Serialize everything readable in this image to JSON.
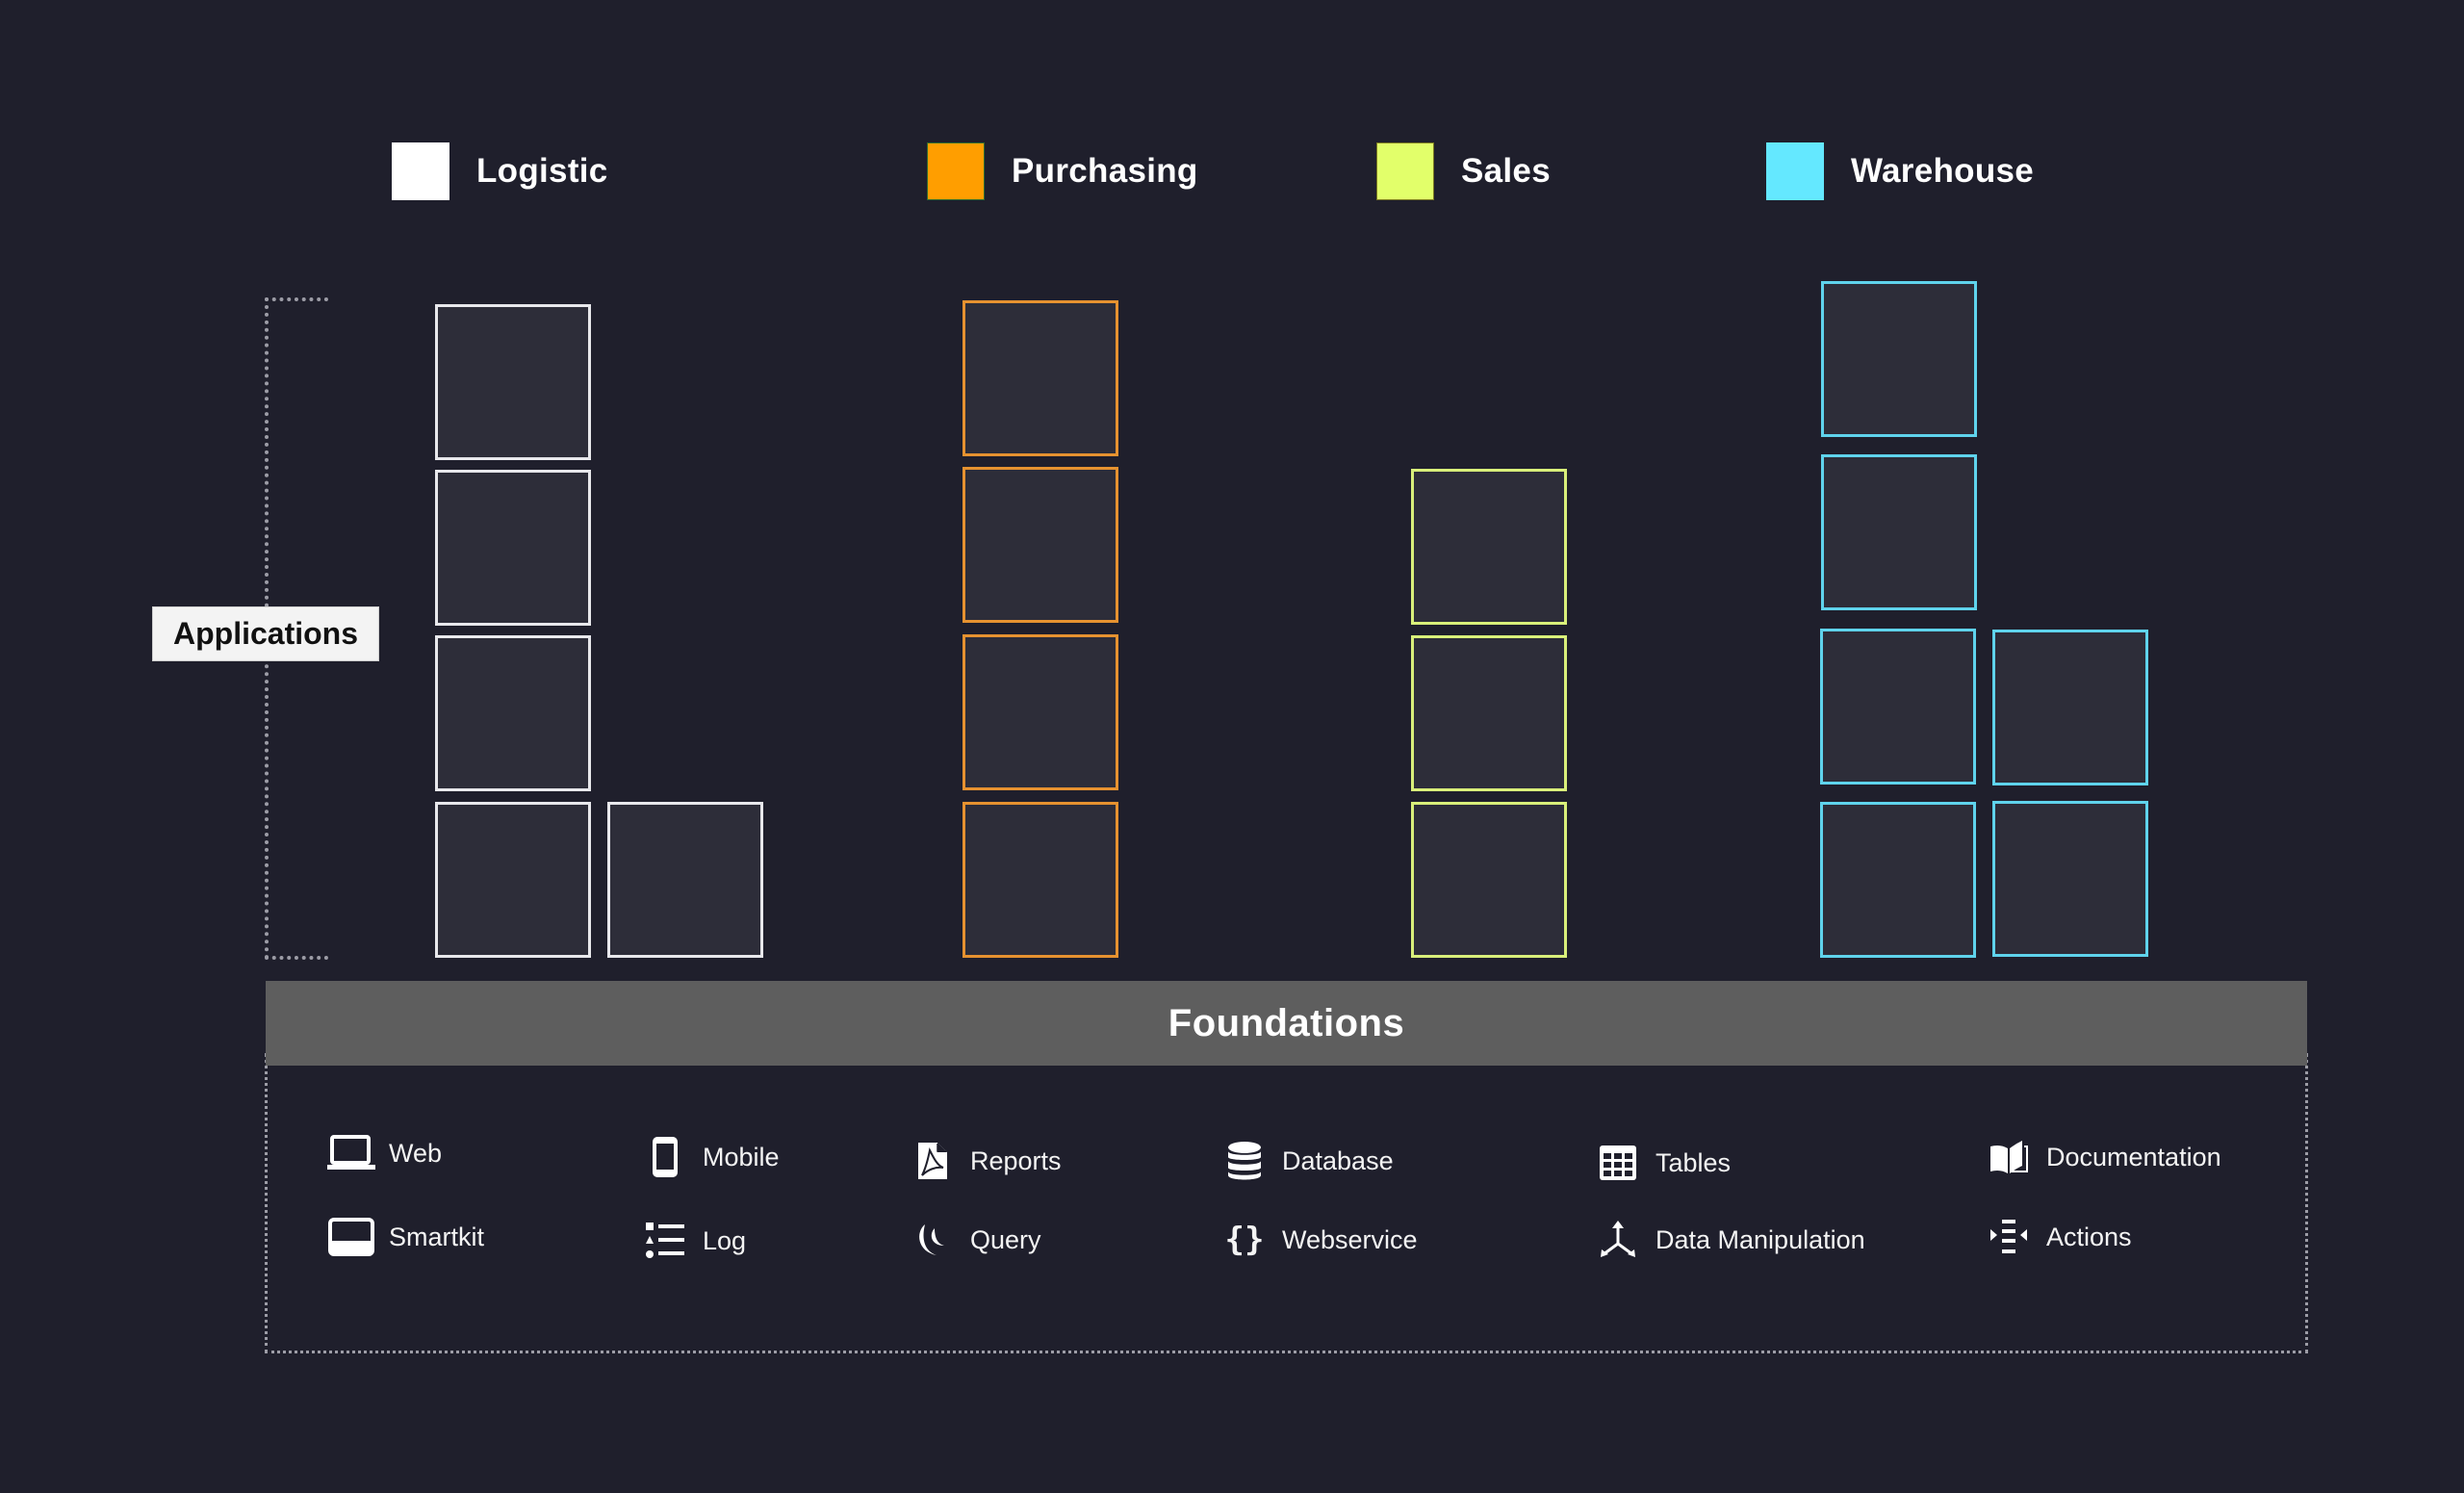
{
  "legend": [
    {
      "label": "Logistic",
      "color": "#ffffff"
    },
    {
      "label": "Purchasing",
      "color": "#ff9e00"
    },
    {
      "label": "Sales",
      "color": "#e2ff6a"
    },
    {
      "label": "Warehouse",
      "color": "#64e8ff"
    }
  ],
  "applications_label": "Applications",
  "block_colors": {
    "logistic": "#e8e8ec",
    "purchasing": "#e69230",
    "sales": "#d9ef7a",
    "warehouse": "#5fd3ec"
  },
  "block_counts": {
    "logistic": 5,
    "purchasing": 4,
    "sales": 3,
    "warehouse": 6
  },
  "foundations": {
    "title": "Foundations",
    "items": [
      {
        "label": "Web",
        "icon": "laptop-icon"
      },
      {
        "label": "Smartkit",
        "icon": "smartkit-icon"
      },
      {
        "label": "Mobile",
        "icon": "mobile-icon"
      },
      {
        "label": "Log",
        "icon": "list-icon"
      },
      {
        "label": "Reports",
        "icon": "pdf-file-icon"
      },
      {
        "label": "Query",
        "icon": "jquery-icon"
      },
      {
        "label": "Database",
        "icon": "database-icon"
      },
      {
        "label": "Webservice",
        "icon": "braces-icon"
      },
      {
        "label": "Tables",
        "icon": "table-icon"
      },
      {
        "label": "Data Manipulation",
        "icon": "split-arrows-icon"
      },
      {
        "label": "Documentation",
        "icon": "book-icon"
      },
      {
        "label": "Actions",
        "icon": "actions-icon"
      }
    ]
  }
}
